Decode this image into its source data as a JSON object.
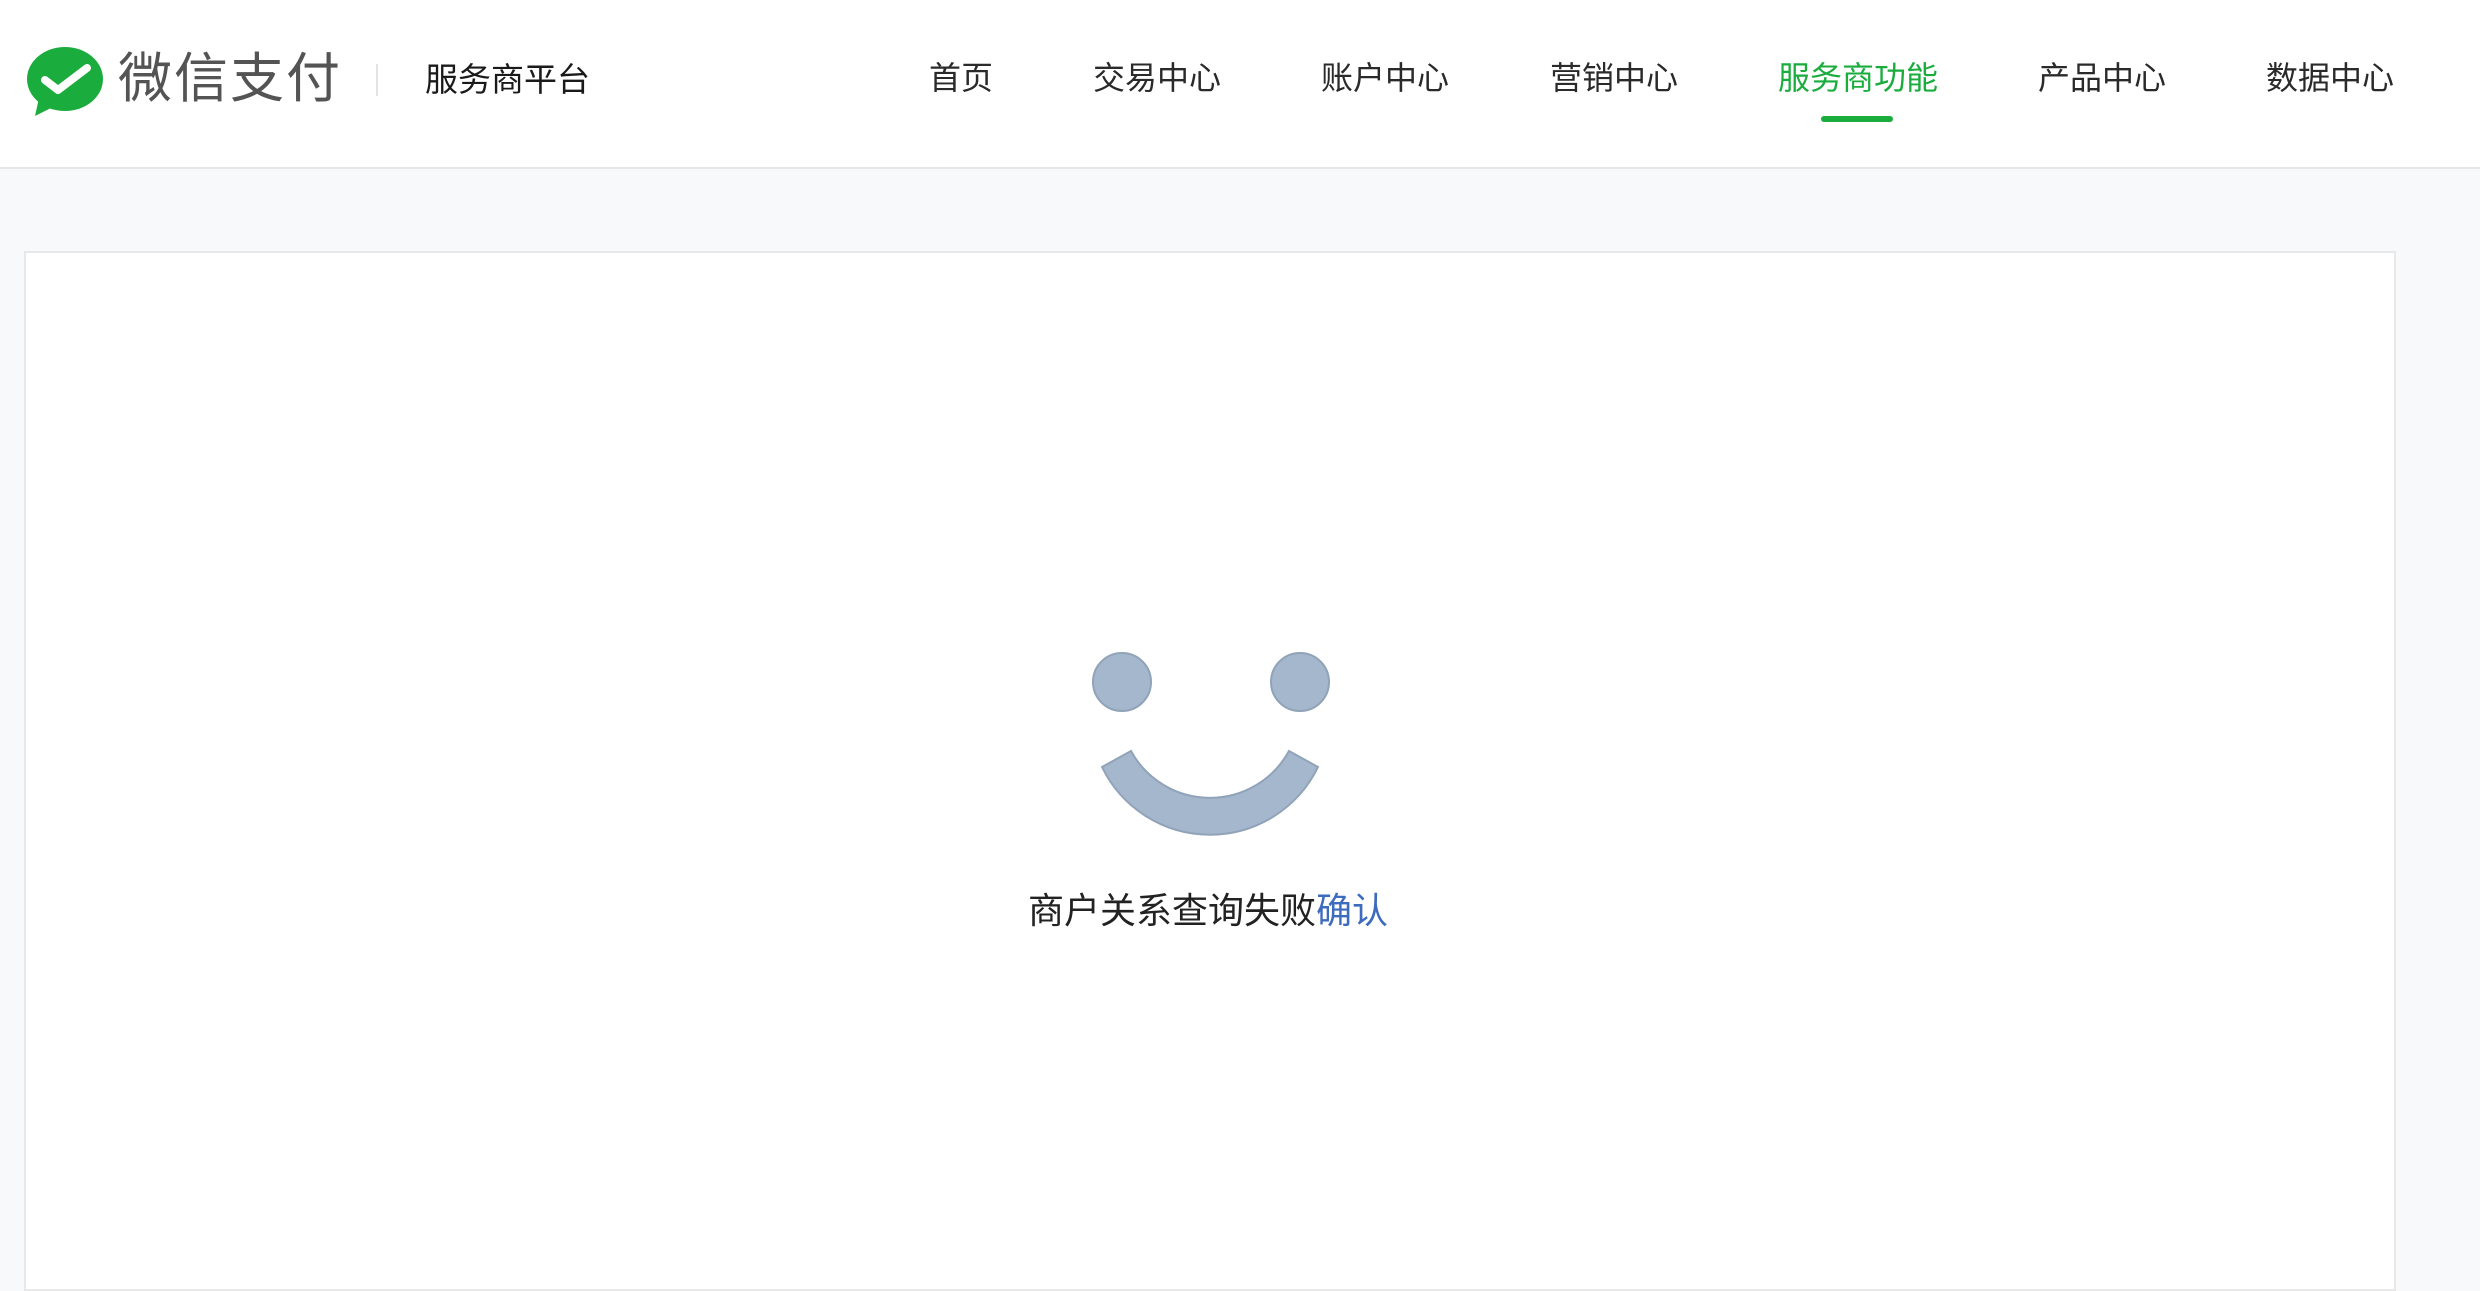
{
  "header": {
    "brand": {
      "logo_icon": "wechat-pay-logo-icon",
      "name": "微信支付"
    },
    "platform_name": "服务商平台",
    "nav": [
      {
        "label": "首页",
        "active": false
      },
      {
        "label": "交易中心",
        "active": false
      },
      {
        "label": "账户中心",
        "active": false
      },
      {
        "label": "营销中心",
        "active": false
      },
      {
        "label": "服务商功能",
        "active": true
      },
      {
        "label": "产品中心",
        "active": false
      },
      {
        "label": "数据中心",
        "active": false
      }
    ]
  },
  "main": {
    "status_icon": "smiley-face-icon",
    "message": "商户关系查询失败",
    "confirm_label": "确认"
  },
  "colors": {
    "brand_green": "#1aad3e",
    "link_blue": "#3d6bbd",
    "icon_gray_blue": "#a5b7cc",
    "page_background": "#f8f9fa"
  }
}
